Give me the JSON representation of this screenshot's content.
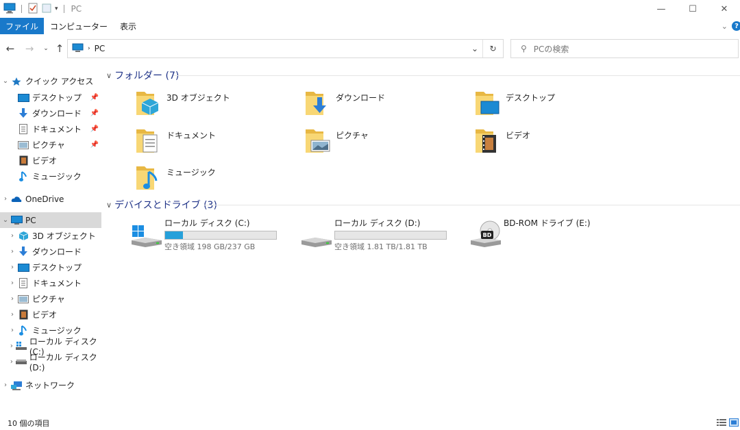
{
  "window": {
    "title": "PC"
  },
  "ribbon": {
    "file": "ファイル",
    "computer": "コンピューター",
    "view": "表示",
    "help": "?"
  },
  "address": {
    "path": [
      "PC"
    ],
    "search_placeholder": "PCの検索"
  },
  "sidebar": {
    "quick_access": "クイック アクセス",
    "quick_items": [
      {
        "label": "デスクトップ",
        "icon": "desktop-icon"
      },
      {
        "label": "ダウンロード",
        "icon": "download-icon"
      },
      {
        "label": "ドキュメント",
        "icon": "document-icon"
      },
      {
        "label": "ピクチャ",
        "icon": "picture-icon"
      },
      {
        "label": "ビデオ",
        "icon": "video-icon"
      },
      {
        "label": "ミュージック",
        "icon": "music-icon"
      }
    ],
    "onedrive": "OneDrive",
    "pc": "PC",
    "pc_items": [
      {
        "label": "3D オブジェクト",
        "icon": "3d-objects-icon"
      },
      {
        "label": "ダウンロード",
        "icon": "download-icon"
      },
      {
        "label": "デスクトップ",
        "icon": "desktop-icon"
      },
      {
        "label": "ドキュメント",
        "icon": "document-icon"
      },
      {
        "label": "ピクチャ",
        "icon": "picture-icon"
      },
      {
        "label": "ビデオ",
        "icon": "video-icon"
      },
      {
        "label": "ミュージック",
        "icon": "music-icon"
      },
      {
        "label": "ローカル ディスク (C:)",
        "icon": "windows-drive-icon"
      },
      {
        "label": "ローカル ディスク (D:)",
        "icon": "drive-icon"
      }
    ],
    "network": "ネットワーク"
  },
  "main": {
    "folders_header": "フォルダー (7)",
    "folders": [
      {
        "label": "3D オブジェクト",
        "icon": "3d-objects-folder-icon"
      },
      {
        "label": "ダウンロード",
        "icon": "downloads-folder-icon"
      },
      {
        "label": "デスクトップ",
        "icon": "desktop-folder-icon"
      },
      {
        "label": "ドキュメント",
        "icon": "documents-folder-icon"
      },
      {
        "label": "ピクチャ",
        "icon": "pictures-folder-icon"
      },
      {
        "label": "ビデオ",
        "icon": "videos-folder-icon"
      },
      {
        "label": "ミュージック",
        "icon": "music-folder-icon"
      }
    ],
    "devices_header": "デバイスとドライブ (3)",
    "drives": [
      {
        "label": "ローカル ディスク (C:)",
        "free": "空き領域 198 GB/237 GB",
        "used_fraction": 0.16,
        "icon": "windows-drive-icon"
      },
      {
        "label": "ローカル ディスク (D:)",
        "free": "空き領域 1.81 TB/1.81 TB",
        "used_fraction": 0.0,
        "icon": "drive-icon"
      },
      {
        "label": "BD-ROM ドライブ (E:)",
        "free": "",
        "icon": "bd-rom-drive-icon"
      }
    ]
  },
  "status": {
    "items": "10 個の項目"
  },
  "colors": {
    "accent": "#1979ca",
    "header_text": "#1e3287",
    "bar_fill": "#26a0da",
    "folder": "#f8d775"
  }
}
